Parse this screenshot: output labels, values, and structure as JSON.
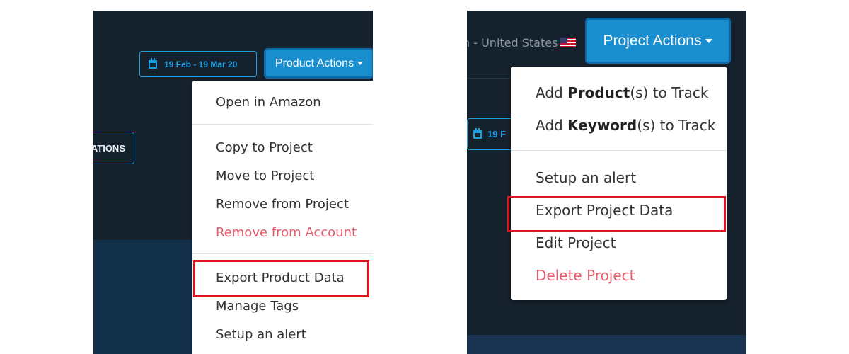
{
  "left": {
    "date_range": "19 Feb - 19 Mar 20",
    "actions_label": "Product Actions",
    "partial_button": "ATIONS",
    "menu": {
      "open_in_amazon": "Open in Amazon",
      "copy_to_project": "Copy to Project",
      "move_to_project": "Move to Project",
      "remove_from_project": "Remove from Project",
      "remove_from_account": "Remove from Account",
      "export_product_data": "Export Product Data",
      "manage_tags": "Manage Tags",
      "setup_alert": "Setup an alert"
    }
  },
  "right": {
    "country": "n - United States",
    "actions_label": "Project Actions",
    "partial_date": "19 F",
    "menu": {
      "add_products_prefix": "Add ",
      "add_products_bold": "Product",
      "add_products_suffix": "(s) to Track",
      "add_keywords_prefix": "Add ",
      "add_keywords_bold": "Keyword",
      "add_keywords_suffix": "(s) to Track",
      "setup_alert": "Setup an alert",
      "export_project_data": "Export Project Data",
      "edit_project": "Edit Project",
      "delete_project": "Delete Project"
    }
  },
  "colors": {
    "panel_bg": "#15212c",
    "accent": "#1a8fd0",
    "outline": "#1aa0e0",
    "danger": "#e45b6a",
    "highlight": "#e1141e"
  },
  "icons": [
    "calendar-icon",
    "caret-down-icon",
    "us-flag-icon"
  ]
}
